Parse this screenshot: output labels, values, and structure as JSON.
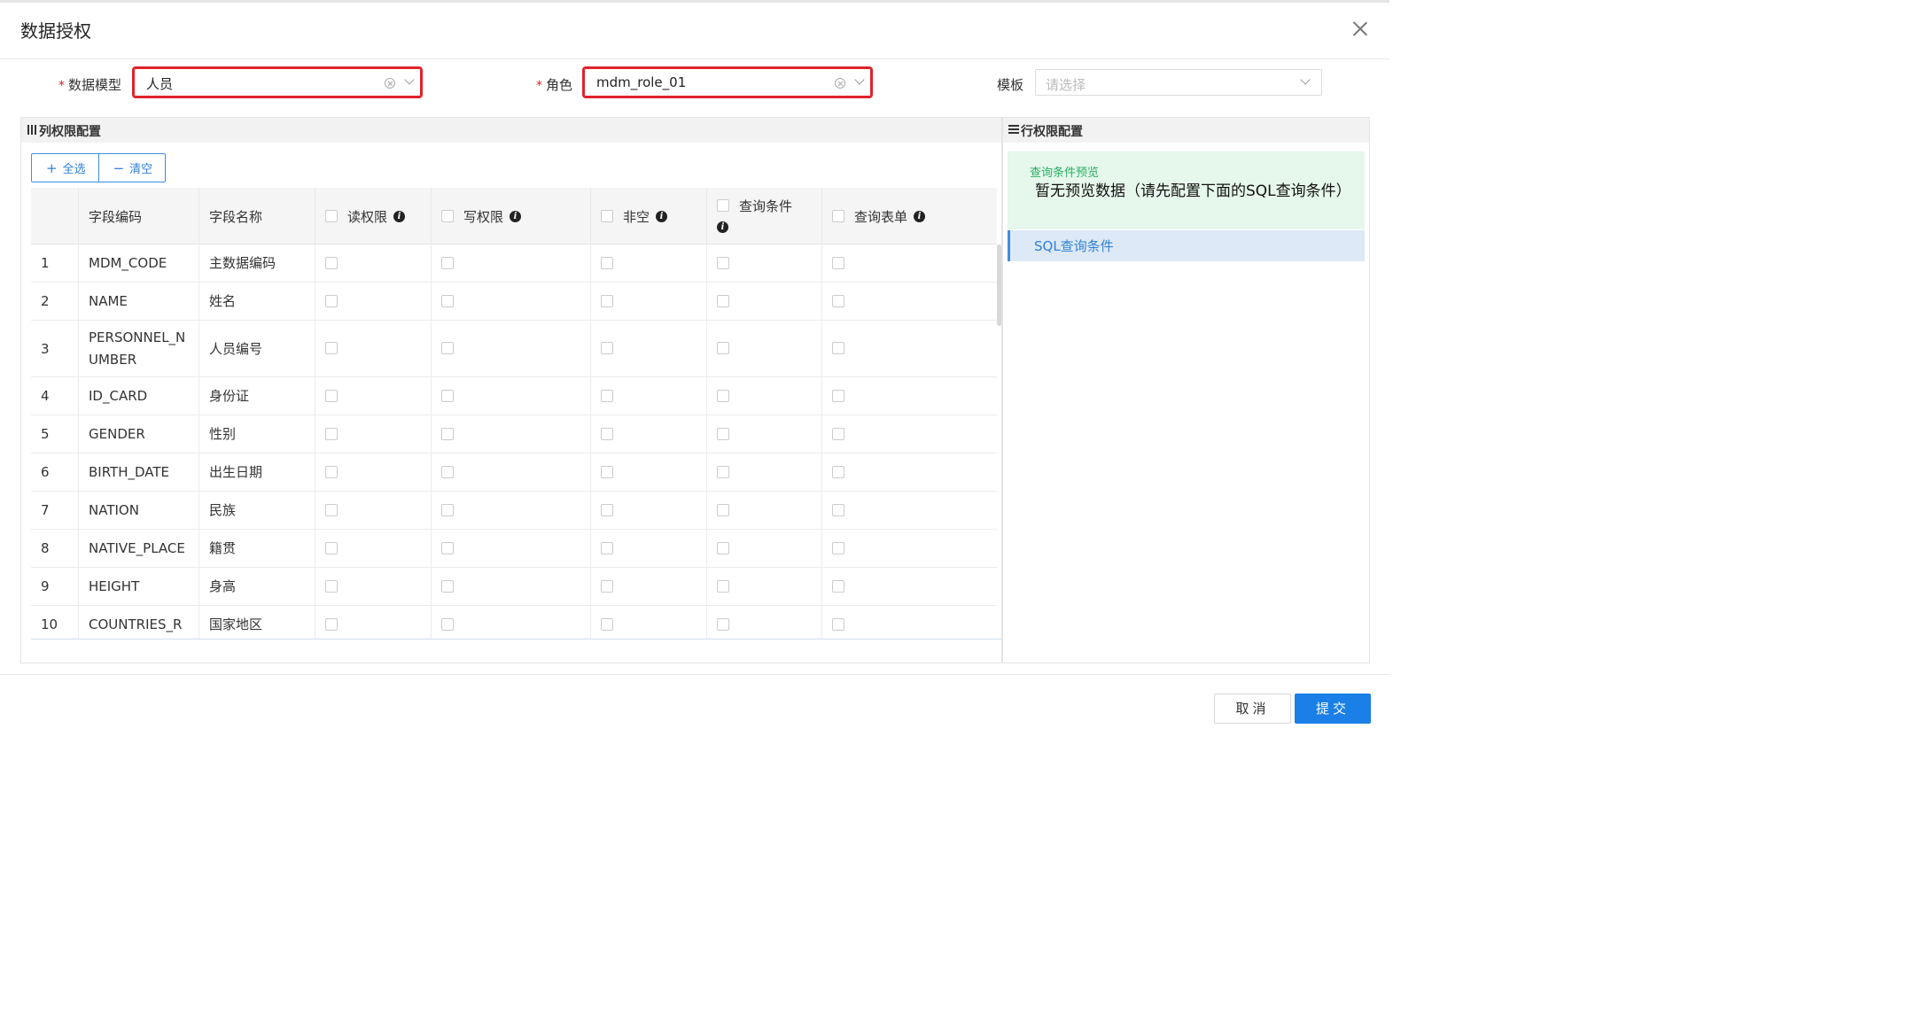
{
  "dialog": {
    "title": "数据授权",
    "close_icon": "close-icon"
  },
  "form": {
    "model": {
      "label": "数据模型",
      "required": "*",
      "value": "人员"
    },
    "role": {
      "label": "角色",
      "required": "*",
      "value": "mdm_role_01"
    },
    "template": {
      "label": "模板",
      "placeholder": "请选择"
    }
  },
  "column_panel": {
    "title": "列权限配置",
    "select_all": "全选",
    "clear": "清空",
    "headers": {
      "code": "字段编码",
      "name": "字段名称",
      "read": "读权限",
      "write": "写权限",
      "not_null": "非空",
      "query_cond": "查询条件",
      "query_form": "查询表单"
    },
    "rows": [
      {
        "index": "1",
        "code": "MDM_CODE",
        "name": "主数据编码"
      },
      {
        "index": "2",
        "code": "NAME",
        "name": "姓名"
      },
      {
        "index": "3",
        "code": "PERSONNEL_N UMBER",
        "name": "人员编号"
      },
      {
        "index": "4",
        "code": "ID_CARD",
        "name": "身份证"
      },
      {
        "index": "5",
        "code": "GENDER",
        "name": "性别"
      },
      {
        "index": "6",
        "code": "BIRTH_DATE",
        "name": "出生日期"
      },
      {
        "index": "7",
        "code": "NATION",
        "name": "民族"
      },
      {
        "index": "8",
        "code": "NATIVE_PLACE",
        "name": "籍贯"
      },
      {
        "index": "9",
        "code": "HEIGHT",
        "name": "身高"
      },
      {
        "index": "10",
        "code": "COUNTRIES_R",
        "name": "国家地区"
      }
    ]
  },
  "row_panel": {
    "title": "行权限配置",
    "preview_title": "查询条件预览",
    "preview_body": "暂无预览数据（请先配置下面的SQL查询条件）",
    "sql_tab": "SQL查询条件"
  },
  "footer": {
    "cancel": "取消",
    "submit": "提交"
  },
  "colors": {
    "primary": "#1a7fe6",
    "highlight_border": "#e0222a",
    "preview_bg": "#e6f7ec",
    "preview_title": "#27b060"
  }
}
